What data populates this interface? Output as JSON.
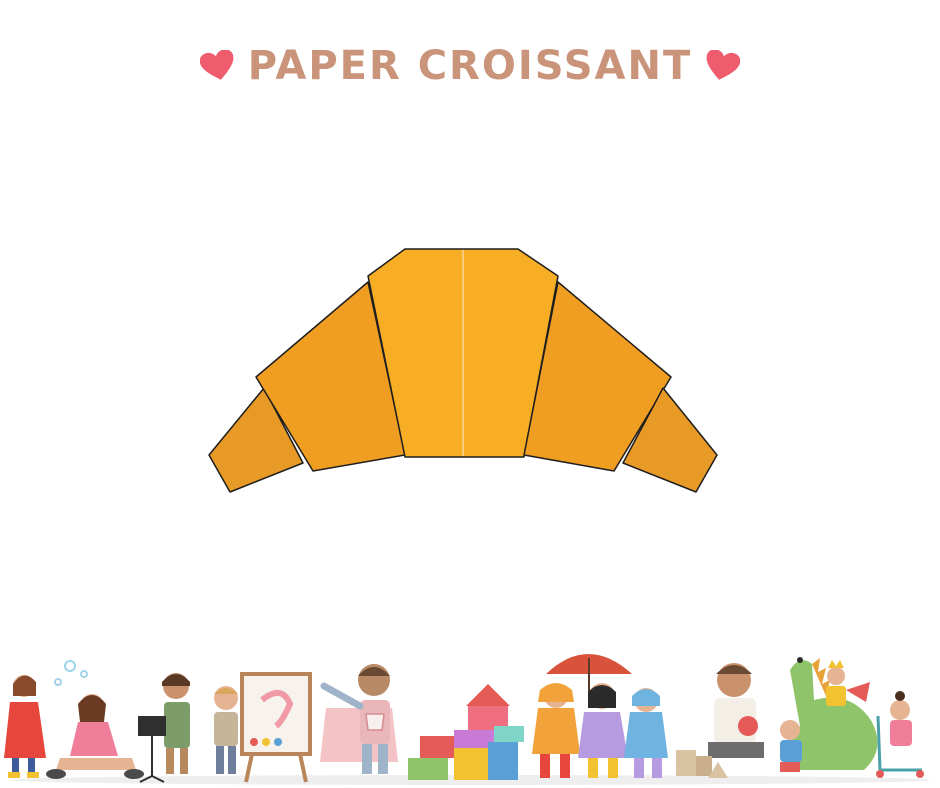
{
  "header": {
    "title": "PAPER CROISSANT",
    "left_icon": "heart-icon",
    "right_icon": "heart-icon"
  },
  "colors": {
    "title": "#c9947a",
    "heart": "#ee5c6e",
    "croissant_center": "#f7ad24",
    "croissant_mid": "#f09e22",
    "croissant_tip": "#e89a26",
    "outline": "#1e1e1e"
  },
  "illustration": {
    "main": "paper-croissant-icon",
    "footer": "children-playing-illustration"
  }
}
